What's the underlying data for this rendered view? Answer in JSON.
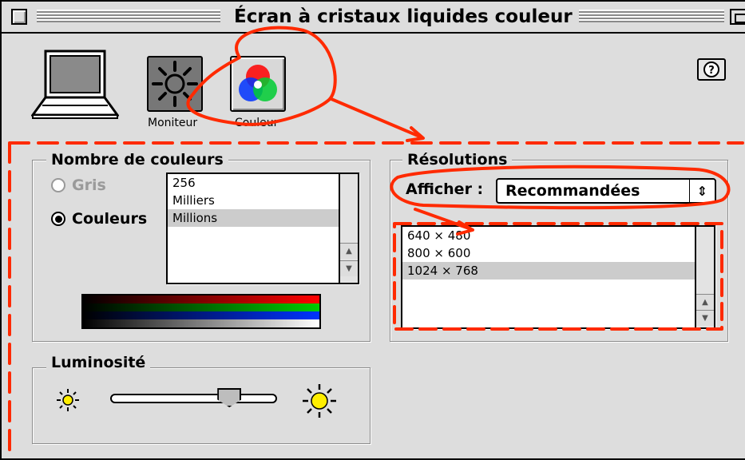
{
  "window": {
    "title": "Écran à cristaux liquides couleur"
  },
  "toolbar": {
    "monitor_label": "Moniteur",
    "color_label": "Couleur",
    "help_icon": "question-mark-icon"
  },
  "colors_group": {
    "title": "Nombre de couleurs",
    "radio_gray": "Gris",
    "radio_colors": "Couleurs",
    "selected_mode": "Couleurs",
    "depth_options": [
      "256",
      "Milliers",
      "Millions"
    ],
    "selected_depth": "Millions"
  },
  "resolutions_group": {
    "title": "Résolutions",
    "show_label": "Afficher :",
    "show_value": "Recommandées",
    "items": [
      "640 × 480",
      "800 × 600",
      "1024 × 768"
    ],
    "selected": "1024 × 768"
  },
  "brightness_group": {
    "title": "Luminosité",
    "level": 0.75
  },
  "annotation_color": "#ff2a00"
}
